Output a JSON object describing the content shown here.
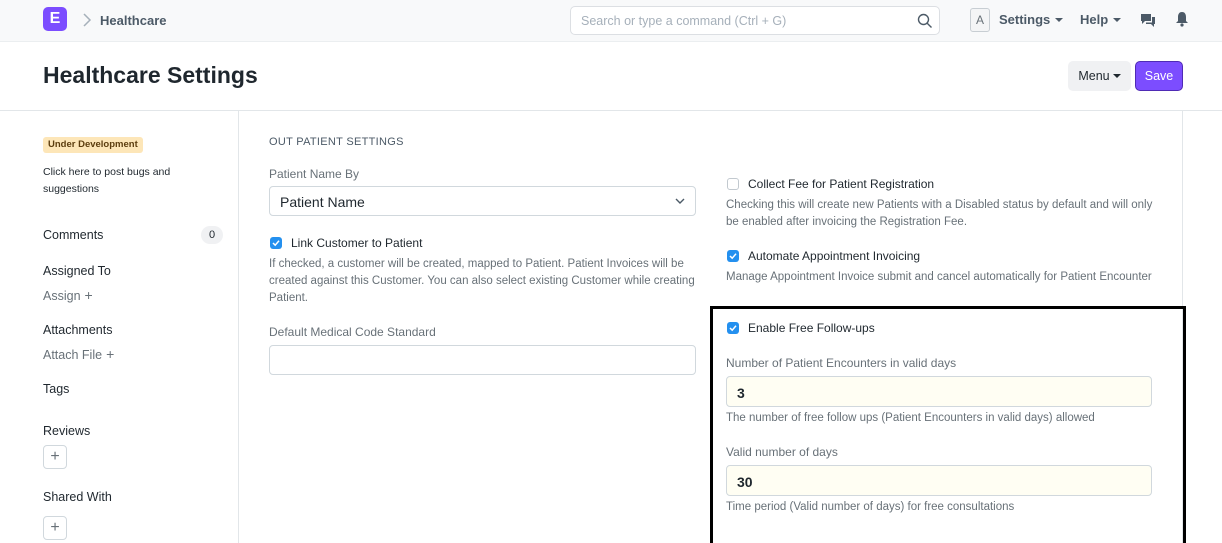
{
  "navbar": {
    "logo_letter": "E",
    "breadcrumb": "Healthcare",
    "search_placeholder": "Search or type a command (Ctrl + G)",
    "avatar_letter": "A",
    "settings_label": "Settings",
    "help_label": "Help"
  },
  "page": {
    "title": "Healthcare Settings",
    "menu_label": "Menu",
    "save_label": "Save"
  },
  "sidebar": {
    "badge": "Under Development",
    "bug_link": "Click here to post bugs and suggestions",
    "comments_label": "Comments",
    "comments_count": "0",
    "assigned_to_label": "Assigned To",
    "assign_label": "Assign",
    "attachments_label": "Attachments",
    "attach_file_label": "Attach File",
    "tags_label": "Tags",
    "reviews_label": "Reviews",
    "shared_with_label": "Shared With"
  },
  "form": {
    "section_title": "OUT PATIENT SETTINGS",
    "patient_name_by": {
      "label": "Patient Name By",
      "value": "Patient Name"
    },
    "link_customer": {
      "label": "Link Customer to Patient",
      "checked": true,
      "description": "If checked, a customer will be created, mapped to Patient. Patient Invoices will be created against this Customer. You can also select existing Customer while creating Patient."
    },
    "default_medical_code": {
      "label": "Default Medical Code Standard",
      "value": ""
    },
    "collect_fee": {
      "label": "Collect Fee for Patient Registration",
      "checked": false,
      "description": "Checking this will create new Patients with a Disabled status by default and will only be enabled after invoicing the Registration Fee."
    },
    "automate_invoicing": {
      "label": "Automate Appointment Invoicing",
      "checked": true,
      "description": "Manage Appointment Invoice submit and cancel automatically for Patient Encounter"
    },
    "free_followups": {
      "label": "Enable Free Follow-ups",
      "checked": true
    },
    "num_encounters": {
      "label": "Number of Patient Encounters in valid days",
      "value": "3",
      "description": "The number of free follow ups (Patient Encounters in valid days) allowed"
    },
    "valid_days": {
      "label": "Valid number of days",
      "value": "30",
      "description": "Time period (Valid number of days) for free consultations"
    }
  },
  "colors": {
    "brand": "#7c4dff",
    "checkbox": "#2490ef",
    "highlight_border": "#000000"
  }
}
